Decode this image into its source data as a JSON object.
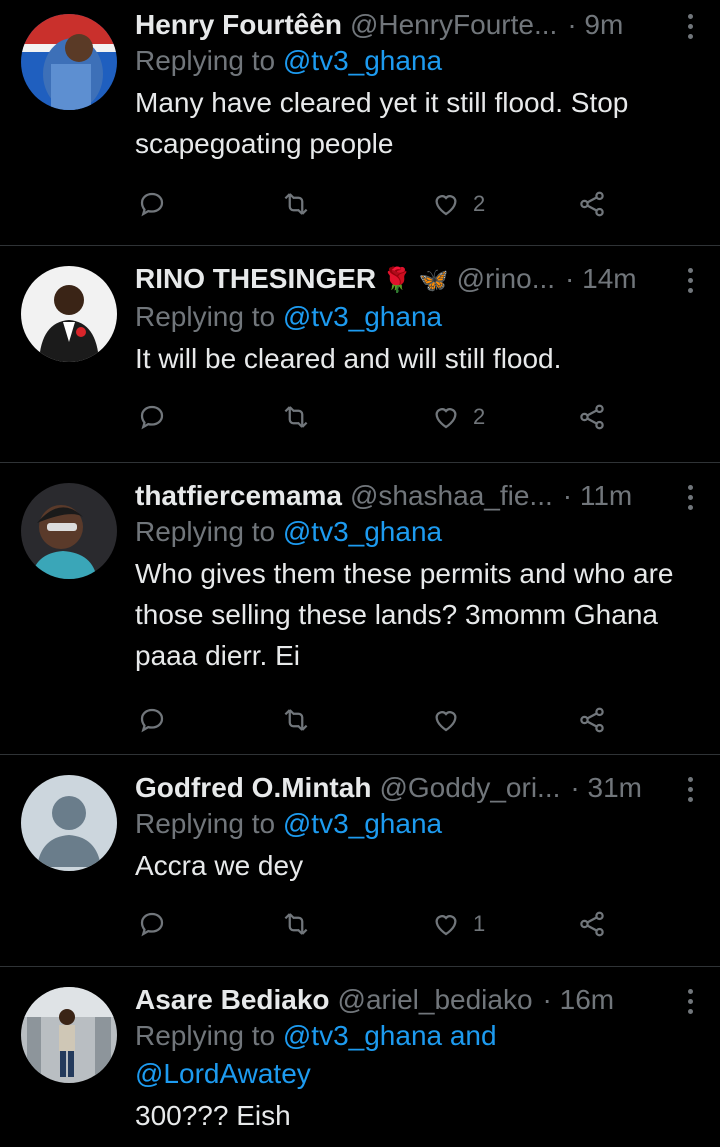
{
  "tweets": [
    {
      "name": "Henry Fourtêên",
      "handle": "@HenryFourte...",
      "time": "· 9m",
      "replying_prefix": "Replying to ",
      "replying_to": "@tv3_ghana",
      "text": "Many have cleared yet it still flood. Stop scapegoating people",
      "likes": "2"
    },
    {
      "name": "RINO THESINGER",
      "emojis": "🌹 🦋",
      "handle": "@rino...",
      "time": "· 14m",
      "replying_prefix": "Replying to ",
      "replying_to": "@tv3_ghana",
      "text": "It will be cleared and will still flood.",
      "likes": "2"
    },
    {
      "name": "thatfiercemama",
      "handle": "@shashaa_fie...",
      "time": "· 11m",
      "replying_prefix": "Replying to ",
      "replying_to": "@tv3_ghana",
      "text": "Who gives them these permits and who are those selling these lands? 3momm Ghana paaa dierr. Ei",
      "likes": ""
    },
    {
      "name": "Godfred O.Mintah",
      "handle": "@Goddy_ori...",
      "time": "· 31m",
      "replying_prefix": "Replying to ",
      "replying_to": "@tv3_ghana",
      "text": "Accra we dey",
      "likes": "1"
    },
    {
      "name": "Asare Bediako",
      "handle": "@ariel_bediako",
      "time": "· 16m",
      "replying_prefix": "Replying to ",
      "replying_to": "@tv3_ghana and @LordAwatey",
      "text": "300??? Eish",
      "likes": ""
    }
  ],
  "icons": {
    "reply": "reply-icon",
    "retweet": "retweet-icon",
    "like": "heart-icon",
    "share": "share-icon",
    "more": "more-icon"
  },
  "colors": {
    "background": "#000000",
    "text": "#e7e9ea",
    "muted": "#71767b",
    "link": "#1d9bf0",
    "divider": "#2f3336"
  }
}
